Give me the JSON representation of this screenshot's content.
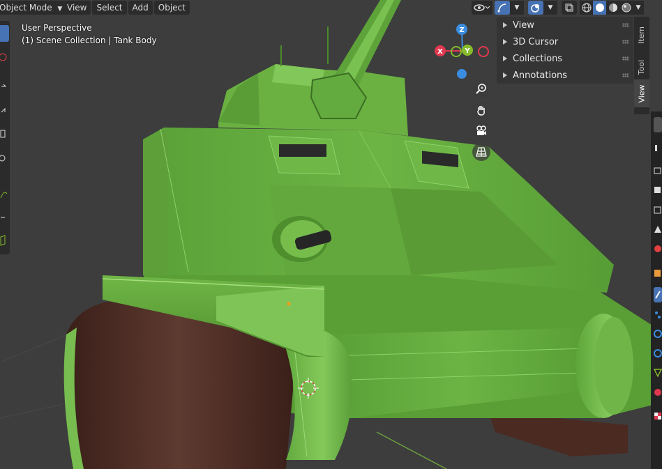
{
  "header": {
    "mode_label": "Object Mode",
    "menus": [
      "View",
      "Select",
      "Add",
      "Object"
    ]
  },
  "viewport_info": {
    "perspective": "User Perspective",
    "collection": "(1) Scene Collection | Tank Body"
  },
  "gizmo": {
    "x": "X",
    "y": "Y",
    "z": "Z"
  },
  "sidebar_panels": [
    "View",
    "3D Cursor",
    "Collections",
    "Annotations"
  ],
  "sidebar_tabs": [
    "Item",
    "Tool",
    "View"
  ],
  "colors": {
    "background": "#3d3d3d",
    "tank_green": "#6ab142",
    "track_brown": "#4a2a22",
    "axis_x": "#e0384f",
    "axis_y": "#86bb2b",
    "axis_z": "#3a8de0"
  }
}
